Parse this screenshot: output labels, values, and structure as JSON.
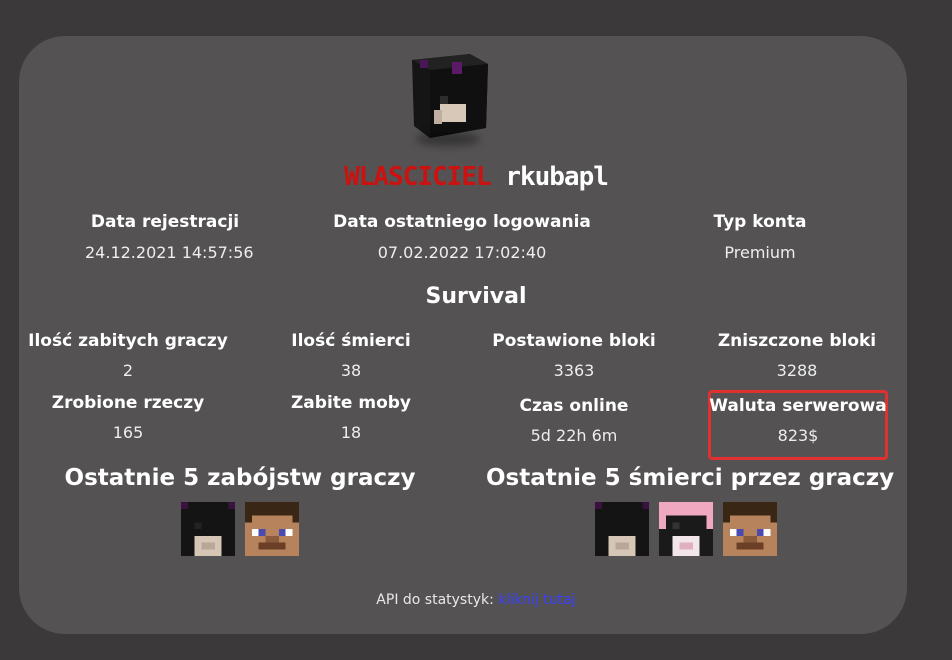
{
  "profile": {
    "rank": "WLASCICIEL",
    "nickname": "rkubapl",
    "head_icon": "player-head-icon"
  },
  "info": [
    {
      "label": "Data rejestracji",
      "value": "24.12.2021 14:57:56"
    },
    {
      "label": "Data ostatniego logowania",
      "value": "07.02.2022 17:02:40"
    },
    {
      "label": "Typ konta",
      "value": "Premium"
    }
  ],
  "survival": {
    "title": "Survival",
    "stats": [
      {
        "label": "Ilość zabitych graczy",
        "value": "2"
      },
      {
        "label": "Ilość śmierci",
        "value": "38"
      },
      {
        "label": "Postawione bloki",
        "value": "3363"
      },
      {
        "label": "Zniszczone bloki",
        "value": "3288"
      },
      {
        "label": "Zrobione rzeczy",
        "value": "165"
      },
      {
        "label": "Zabite moby",
        "value": "18"
      },
      {
        "label": "Czas online",
        "value": "5d 22h 6m"
      },
      {
        "label": "Waluta serwerowa",
        "value": "823$"
      }
    ]
  },
  "kills": {
    "title": "Ostatnie 5 zabójstw graczy",
    "heads": [
      "enderman-head-icon",
      "steve-head-icon"
    ]
  },
  "deaths": {
    "title": "Ostatnie 5 śmierci przez graczy",
    "heads": [
      "enderman-head-icon",
      "pink-skin-head-icon",
      "steve-head-icon"
    ]
  },
  "footer": {
    "text": "API do statystyk:",
    "link": "kliknij tutaj"
  },
  "colors": {
    "background": "#3b3939",
    "card": "#545252",
    "rank": "#cc1111",
    "highlight_border": "#e03030",
    "link": "#3b42ff"
  }
}
